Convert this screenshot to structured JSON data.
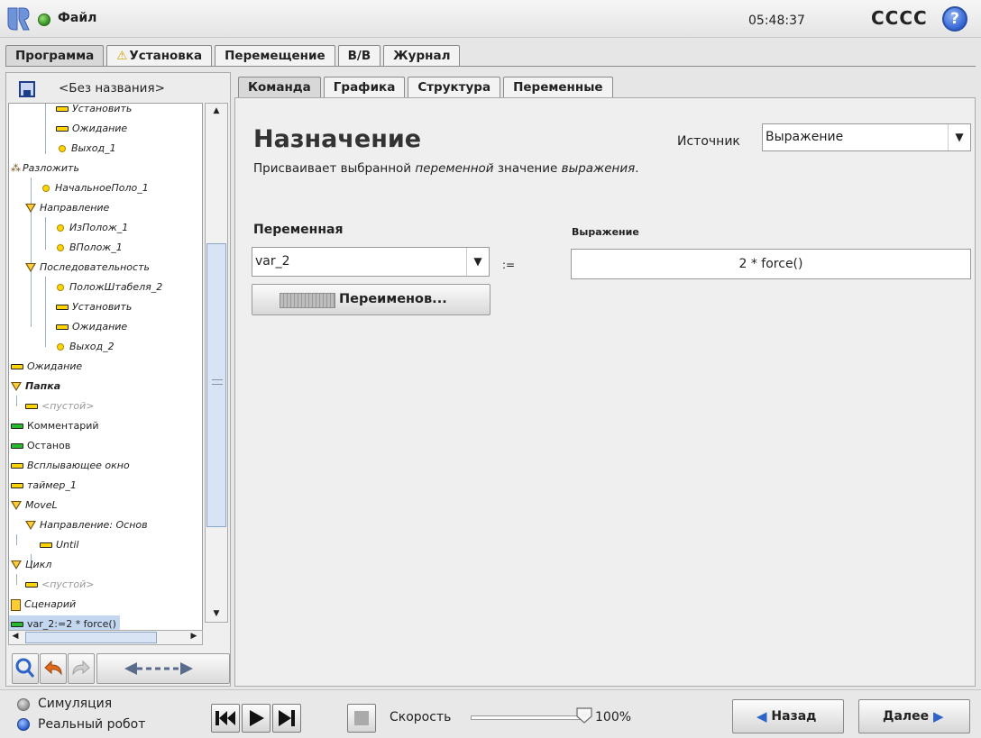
{
  "header": {
    "file_menu": "Файл",
    "clock": "05:48:37",
    "robot_name": "CCCC",
    "help_glyph": "?"
  },
  "main_tabs": [
    {
      "label": "Программа",
      "active": true
    },
    {
      "label": "Установка",
      "warning": true
    },
    {
      "label": "Перемещение"
    },
    {
      "label": "В/В"
    },
    {
      "label": "Журнал"
    }
  ],
  "program": {
    "name": "<Без названия>"
  },
  "tree": [
    {
      "label": "Установить",
      "icon": "bar-yellow"
    },
    {
      "label": "Ожидание",
      "icon": "bar-yellow"
    },
    {
      "label": "Выход_1",
      "icon": "waypoint"
    },
    {
      "label": "Разложить",
      "icon": "pallet"
    },
    {
      "label": "НачальноеПоло_1",
      "icon": "waypoint"
    },
    {
      "label": "Направление",
      "icon": "folder"
    },
    {
      "label": "ИзПолож_1",
      "icon": "waypoint"
    },
    {
      "label": "ВПолож_1",
      "icon": "waypoint"
    },
    {
      "label": "Последовательность",
      "icon": "folder"
    },
    {
      "label": "ПоложШтабеля_2",
      "icon": "waypoint"
    },
    {
      "label": "Установить",
      "icon": "bar-yellow"
    },
    {
      "label": "Ожидание",
      "icon": "bar-yellow"
    },
    {
      "label": "Выход_2",
      "icon": "waypoint"
    },
    {
      "label": "Ожидание",
      "icon": "bar-yellow"
    },
    {
      "label": "Папка",
      "icon": "folder"
    },
    {
      "label": "<пустой>",
      "icon": "bar-yellow"
    },
    {
      "label": "Комментарий",
      "icon": "bar-green"
    },
    {
      "label": "Останов",
      "icon": "bar-green"
    },
    {
      "label": "Всплывающее окно",
      "icon": "bar-yellow"
    },
    {
      "label": "таймер_1",
      "icon": "bar-yellow"
    },
    {
      "label": "MoveL",
      "icon": "folder"
    },
    {
      "label": "Направление: Основ",
      "icon": "folder"
    },
    {
      "label": "Until",
      "icon": "bar-yellow"
    },
    {
      "label": "Цикл",
      "icon": "folder"
    },
    {
      "label": "<пустой>",
      "icon": "bar-yellow"
    },
    {
      "label": "Сценарий",
      "icon": "script"
    },
    {
      "label": "var_2:=2 * force()",
      "icon": "bar-green",
      "selected": true
    }
  ],
  "right_tabs": [
    {
      "label": "Команда",
      "active": true
    },
    {
      "label": "Графика"
    },
    {
      "label": "Структура"
    },
    {
      "label": "Переменные"
    }
  ],
  "command": {
    "title": "Назначение",
    "desc_prefix": "Присваивает выбранной ",
    "desc_var": "переменной",
    "desc_mid": " значение ",
    "desc_expr": "выражения",
    "desc_end": ".",
    "source_label": "Источник",
    "source_value": "Выражение",
    "variable_label": "Переменная",
    "variable_value": "var_2",
    "assign_operator": ":=",
    "rename_button": "Переименов...",
    "expression_label": "Выражение",
    "expression_value": "2 * force()"
  },
  "bottom": {
    "simulation": "Симуляция",
    "real_robot": "Реальный робот",
    "speed_label": "Скорость",
    "speed_value": "100%",
    "speed_fraction": 1.0,
    "back_button": "Назад",
    "next_button": "Далее"
  },
  "colors": {
    "accent_blue": "#2e63c8",
    "node_yellow": "#ffd400",
    "node_green": "#27b82b",
    "selection": "#c3d7f0"
  }
}
